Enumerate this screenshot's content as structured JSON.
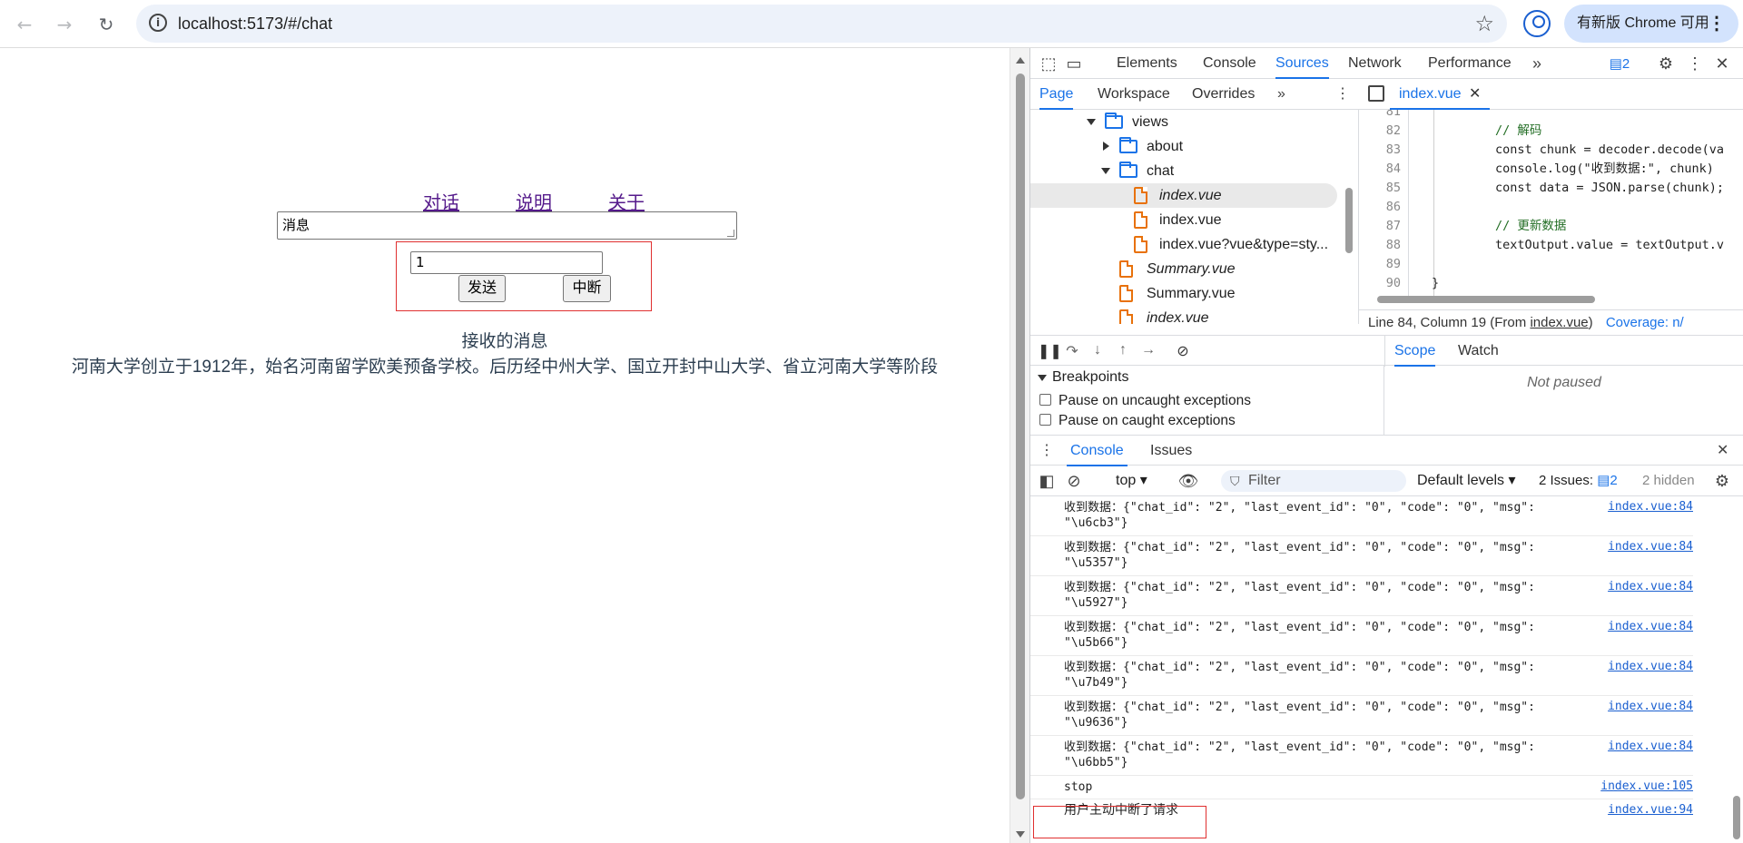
{
  "browser": {
    "url": "localhost:5173/#/chat",
    "update_label": "有新版 Chrome 可用"
  },
  "page": {
    "nav_links": [
      "对话",
      "说明",
      "关于"
    ],
    "message_placeholder": "消息",
    "number_value": "1",
    "send_label": "发送",
    "abort_label": "中断",
    "received_title": "接收的消息",
    "received_text": "河南大学创立于1912年，始名河南留学欧美预备学校。后历经中州大学、国立开封中山大学、省立河南大学等阶段"
  },
  "devtools": {
    "tabs": [
      "Elements",
      "Console",
      "Sources",
      "Network",
      "Performance"
    ],
    "active_tab": "Sources",
    "issues_badge": "2",
    "navigator_tabs": [
      "Page",
      "Workspace",
      "Overrides"
    ],
    "tree": [
      {
        "label": "views",
        "type": "folder",
        "open": true,
        "depth": 0
      },
      {
        "label": "about",
        "type": "folder",
        "open": false,
        "depth": 1
      },
      {
        "label": "chat",
        "type": "folder",
        "open": true,
        "depth": 1
      },
      {
        "label": "index.vue",
        "type": "file",
        "italic": true,
        "depth": 2,
        "selected": true
      },
      {
        "label": "index.vue",
        "type": "file",
        "italic": false,
        "depth": 2
      },
      {
        "label": "index.vue?vue&type=sty...",
        "type": "file",
        "italic": false,
        "depth": 2
      },
      {
        "label": "Summary.vue",
        "type": "file",
        "italic": true,
        "depth": 1
      },
      {
        "label": "Summary.vue",
        "type": "file",
        "italic": false,
        "depth": 1
      },
      {
        "label": "index.vue",
        "type": "file",
        "italic": true,
        "depth": 1
      }
    ],
    "editor_tab": "index.vue",
    "code_lines": [
      {
        "n": "81",
        "text": ""
      },
      {
        "n": "82",
        "text": "// 解码",
        "cls": "cm"
      },
      {
        "n": "83",
        "text": "const chunk = decoder.decode(va",
        "cls": "df"
      },
      {
        "n": "84",
        "text": "console.log(\"收到数据:\", chunk)",
        "cls": "df"
      },
      {
        "n": "85",
        "text": "const data = JSON.parse(chunk);",
        "cls": "df"
      },
      {
        "n": "86",
        "text": ""
      },
      {
        "n": "87",
        "text": "// 更新数据",
        "cls": "cm"
      },
      {
        "n": "88",
        "text": "textOutput.value = textOutput.v",
        "cls": "df"
      },
      {
        "n": "89",
        "text": ""
      },
      {
        "n": "90",
        "text": "}",
        "cls": "df"
      }
    ],
    "status_position": "Line 84, Column 19",
    "status_from_prefix": "(From ",
    "status_from_file": "index.vue",
    "status_from_suffix": ")",
    "status_coverage": "Coverage: n/",
    "scope_tabs": [
      "Scope",
      "Watch"
    ],
    "breakpoints_title": "Breakpoints",
    "bp_uncaught": "Pause on uncaught exceptions",
    "bp_caught": "Pause on caught exceptions",
    "not_paused": "Not paused",
    "drawer_tabs": [
      "Console",
      "Issues"
    ],
    "context": "top",
    "filter_placeholder": "Filter",
    "levels": "Default levels",
    "issues_label": "2 Issues:",
    "issues_count": "2",
    "hidden_label": "2 hidden",
    "logs": [
      {
        "l1": "收到数据：{\"chat_id\": \"2\", \"last_event_id\": \"0\", \"code\": \"0\", \"msg\":",
        "l2": "\"\\u6cb3\"}",
        "src": "index.vue:84"
      },
      {
        "l1": "收到数据：{\"chat_id\": \"2\", \"last_event_id\": \"0\", \"code\": \"0\", \"msg\":",
        "l2": "\"\\u5357\"}",
        "src": "index.vue:84"
      },
      {
        "l1": "收到数据：{\"chat_id\": \"2\", \"last_event_id\": \"0\", \"code\": \"0\", \"msg\":",
        "l2": "\"\\u5927\"}",
        "src": "index.vue:84"
      },
      {
        "l1": "收到数据：{\"chat_id\": \"2\", \"last_event_id\": \"0\", \"code\": \"0\", \"msg\":",
        "l2": "\"\\u5b66\"}",
        "src": "index.vue:84"
      },
      {
        "l1": "收到数据：{\"chat_id\": \"2\", \"last_event_id\": \"0\", \"code\": \"0\", \"msg\":",
        "l2": "\"\\u7b49\"}",
        "src": "index.vue:84"
      },
      {
        "l1": "收到数据：{\"chat_id\": \"2\", \"last_event_id\": \"0\", \"code\": \"0\", \"msg\":",
        "l2": "\"\\u9636\"}",
        "src": "index.vue:84"
      },
      {
        "l1": "收到数据：{\"chat_id\": \"2\", \"last_event_id\": \"0\", \"code\": \"0\", \"msg\":",
        "l2": "\"\\u6bb5\"}",
        "src": "index.vue:84"
      },
      {
        "l1": "stop",
        "l2": "",
        "src": "index.vue:105"
      },
      {
        "l1": "用户主动中断了请求",
        "l2": "",
        "src": "index.vue:94"
      }
    ]
  }
}
